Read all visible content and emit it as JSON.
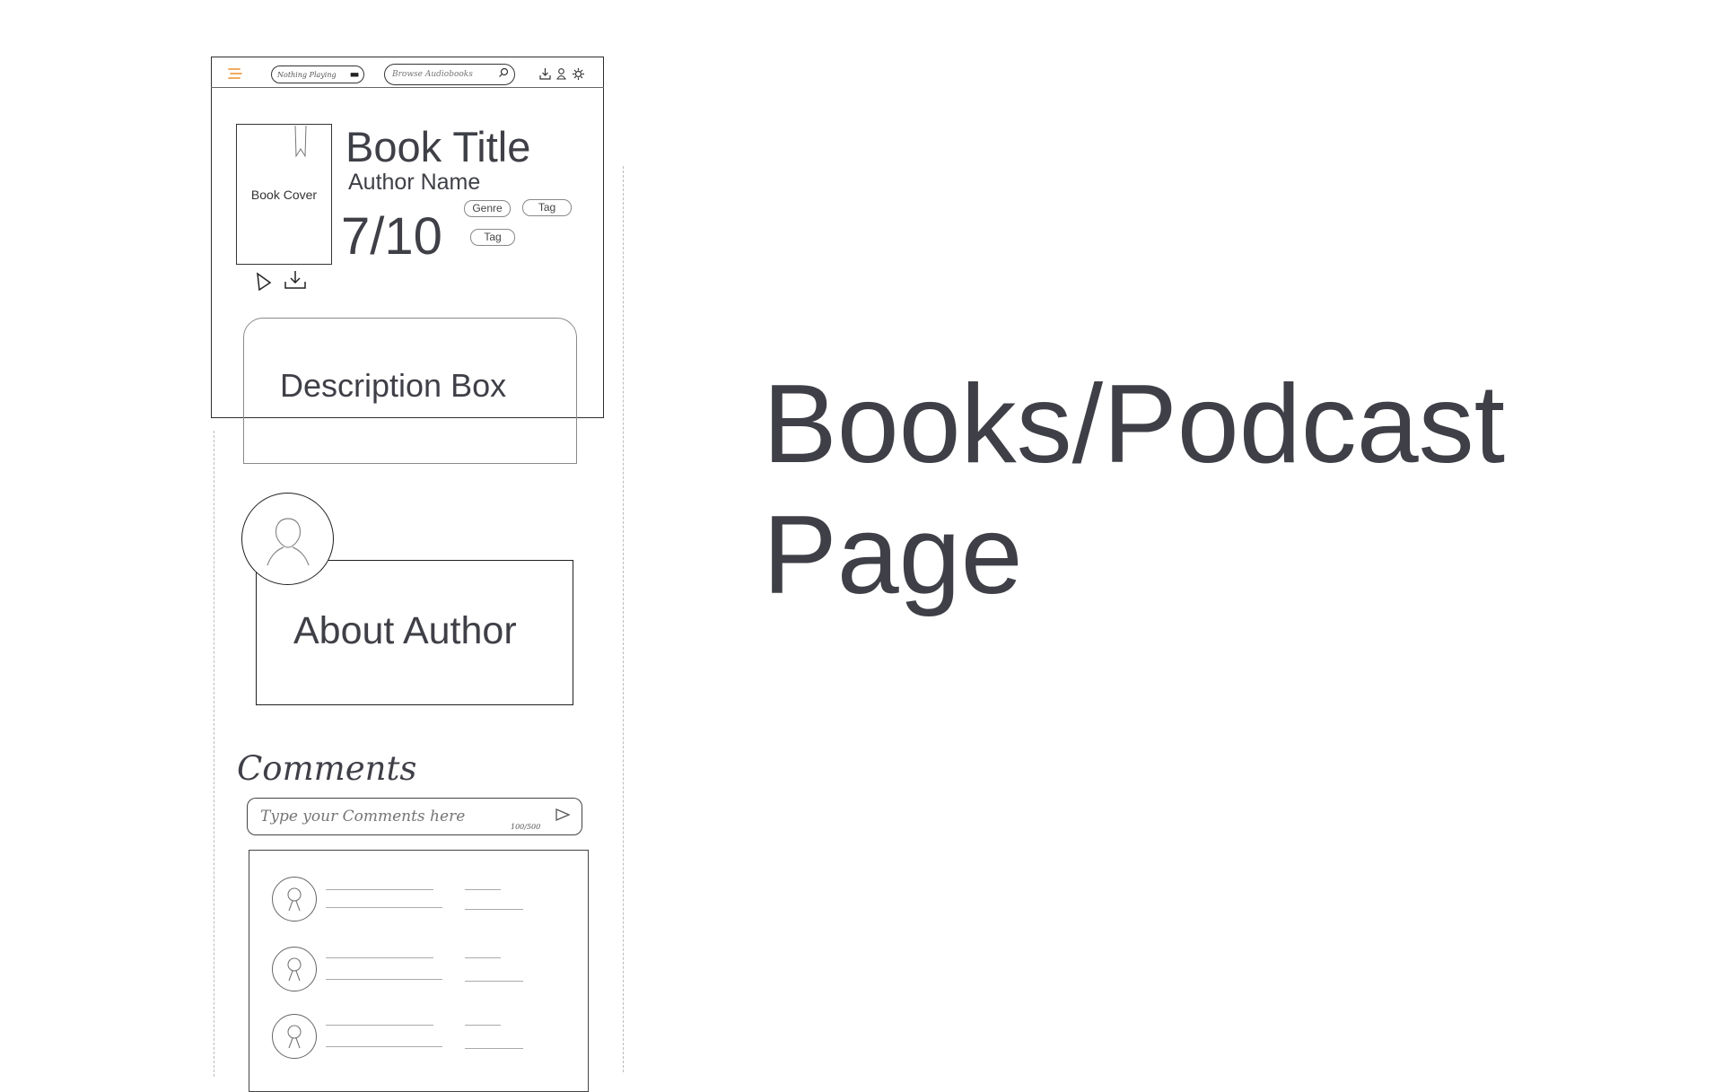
{
  "heading": {
    "line1": "Books/Podcast",
    "line2": "Page"
  },
  "topbar": {
    "player_label": "Nothing Playing",
    "search_placeholder": "Browse Audiobooks"
  },
  "book": {
    "cover_label": "Book Cover",
    "title": "Book Title",
    "author": "Author Name",
    "rating": "7/10",
    "tags": [
      "Genre",
      "Tag",
      "Tag"
    ]
  },
  "description": {
    "label": "Description Box"
  },
  "about": {
    "label": "About Author"
  },
  "comments": {
    "heading": "Comments",
    "input_placeholder": "Type your Comments here",
    "char_count": "100/500"
  },
  "icons": {
    "menu": "hamburger-icon",
    "search": "search-icon",
    "download": "download-icon",
    "profile": "user-icon",
    "settings": "gear-icon",
    "play": "play-icon",
    "send": "send-icon"
  },
  "colors": {
    "menu_accent": "#f0a14a",
    "heading_text": "#3f4047"
  }
}
